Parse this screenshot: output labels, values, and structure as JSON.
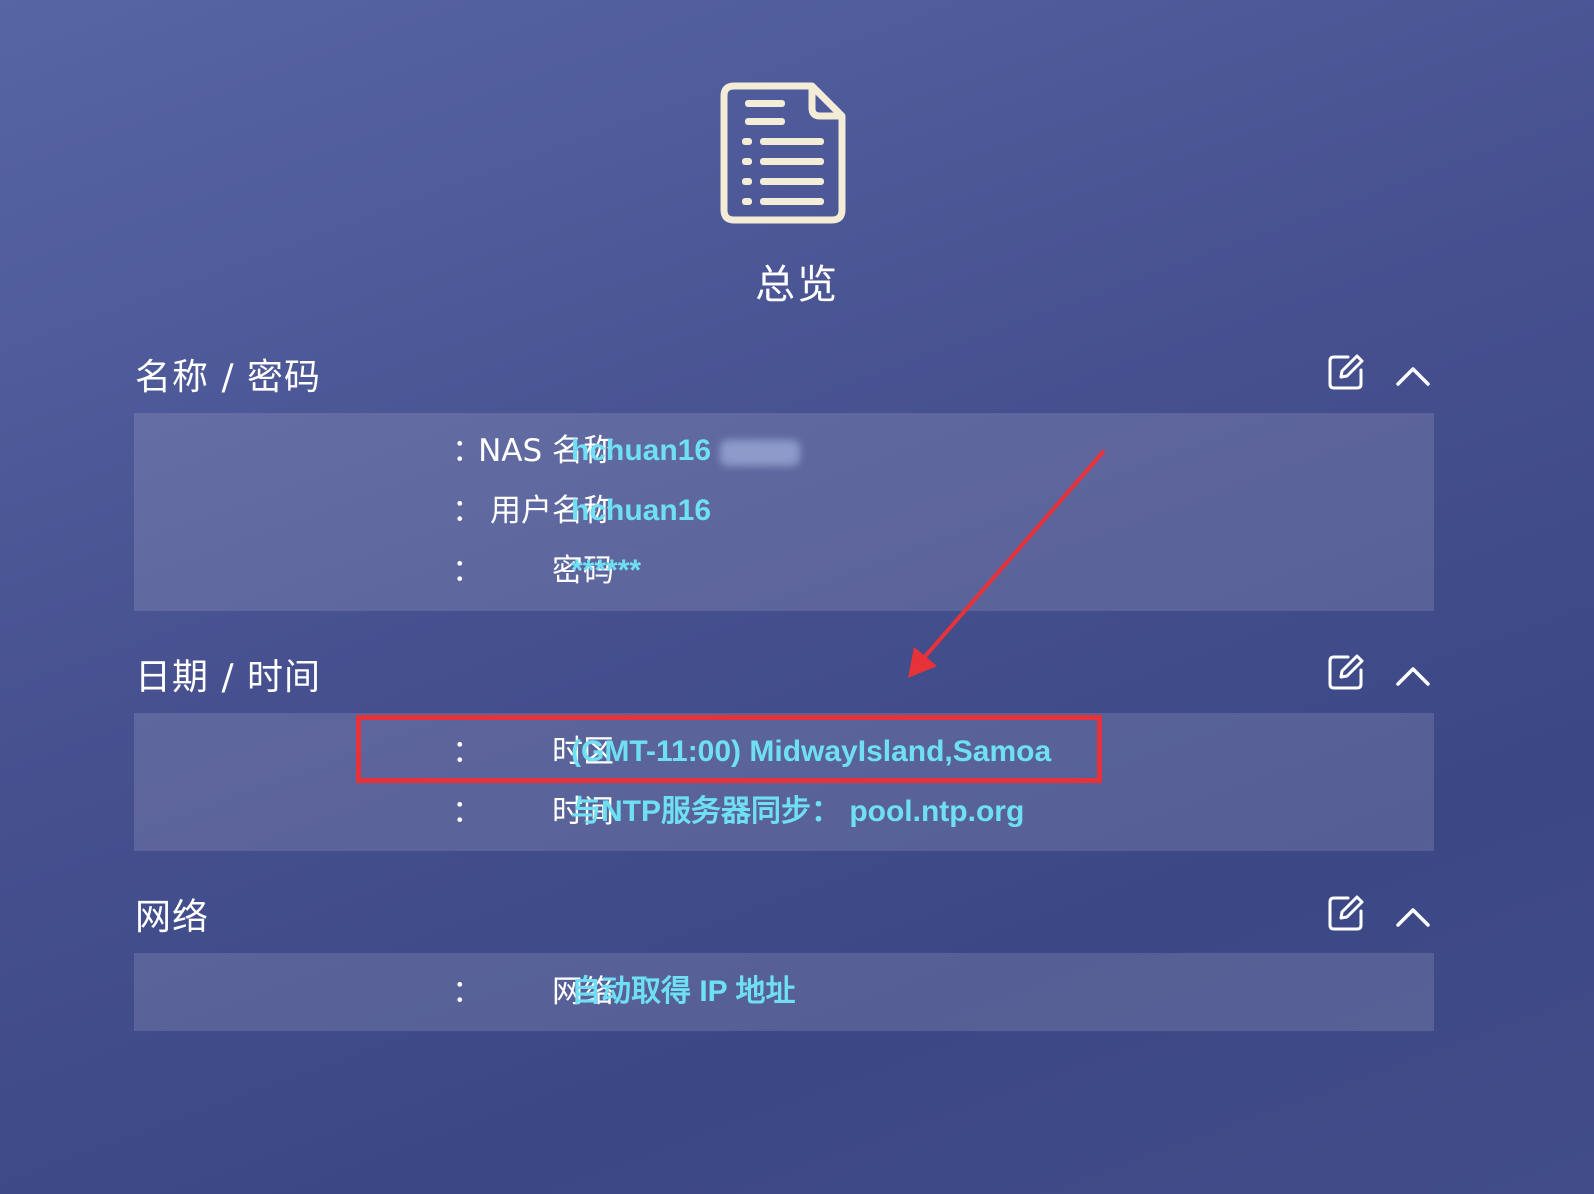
{
  "header": {
    "icon": "document-list-icon",
    "title": "总览"
  },
  "sections": [
    {
      "title": "名称 / 密码",
      "rows": [
        {
          "label": "NAS 名称",
          "value": "hchuan16"
        },
        {
          "label": "用户名称",
          "value": "hchuan16"
        },
        {
          "label": "密码",
          "value": "******"
        }
      ]
    },
    {
      "title": "日期 / 时间",
      "rows": [
        {
          "label": "时区",
          "value": "(GMT-11:00) MidwayIsland,Samoa"
        },
        {
          "label": "时间",
          "value": "与NTP服务器同步： pool.ntp.org"
        }
      ]
    },
    {
      "title": "网络",
      "rows": [
        {
          "label": "网络",
          "value": "自动取得 IP 地址"
        }
      ]
    }
  ],
  "colon": "：",
  "icons": {
    "edit": "edit-icon",
    "collapse": "chevron-up-icon"
  },
  "colors": {
    "value_text": "#6fe0f4",
    "annotation": "#e8323a"
  }
}
